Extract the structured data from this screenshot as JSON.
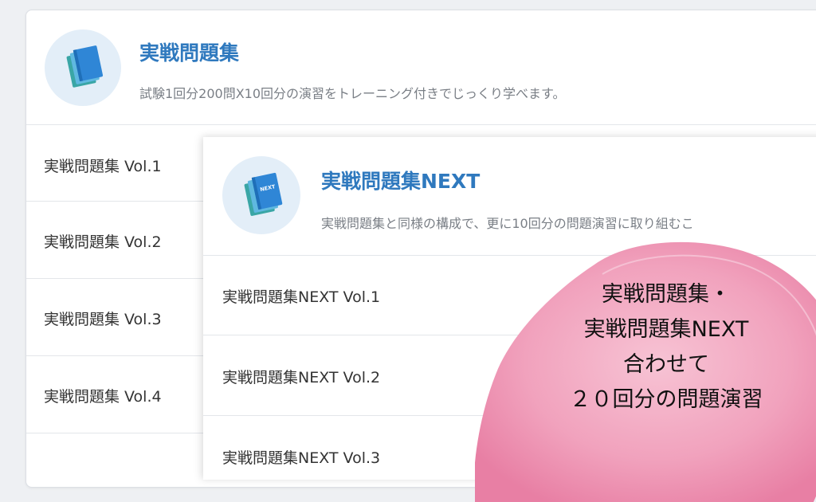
{
  "back_panel": {
    "title": "実戦問題集",
    "description": "試験1回分200問X10回分の演習をトレーニング付きでじっくり学べます。",
    "rows": [
      {
        "label": "実戦問題集 Vol.1"
      },
      {
        "label": "実戦問題集 Vol.2"
      },
      {
        "label": "実戦問題集 Vol.3"
      },
      {
        "label": "実戦問題集 Vol.4"
      }
    ]
  },
  "front_panel": {
    "title": "実戦問題集NEXT",
    "description": "実戦問題集と同様の構成で、更に10回分の問題演習に取り組むこ",
    "icon_label": "NEXT",
    "rows": [
      {
        "label": "実戦問題集NEXT Vol.1"
      },
      {
        "label": "実戦問題集NEXT Vol.2"
      },
      {
        "label": "実戦問題集NEXT Vol.3"
      }
    ]
  },
  "callout": {
    "lines": [
      "実戦問題集・",
      "実戦問題集NEXT",
      "合わせて",
      "２０回分の問題演習"
    ]
  },
  "colors": {
    "title": "#2f79be",
    "icon_bg": "#e3eef8",
    "book_blue": "#2f86d6",
    "book_teal": "#3aa6a6",
    "bubble_pink": "#ee8fb0"
  }
}
